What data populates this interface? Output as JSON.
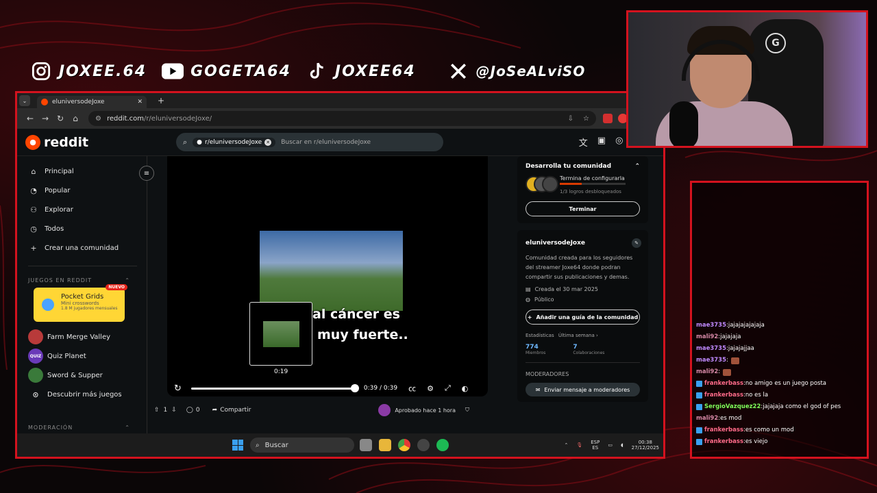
{
  "socials": [
    {
      "icon": "instagram-icon",
      "handle": "JOXEE.64"
    },
    {
      "icon": "youtube-icon",
      "handle": "GOGETA64"
    },
    {
      "icon": "tiktok-icon",
      "handle": "JOXEE64"
    },
    {
      "icon": "x-icon",
      "handle": "@JoSeALviSO"
    }
  ],
  "browser": {
    "tab_title": "eluniversodeJoxe",
    "url_host": "reddit.com",
    "url_path": "/r/eluniversodeJoxe/"
  },
  "reddit": {
    "logo_text": "reddit",
    "search_chip": "r/eluniversodeJoxe",
    "search_placeholder": "Buscar en r/eluniversodeJoxe",
    "nav": [
      {
        "icon": "home-icon",
        "label": "Principal"
      },
      {
        "icon": "popular-icon",
        "label": "Popular"
      },
      {
        "icon": "explore-icon",
        "label": "Explorar"
      },
      {
        "icon": "all-icon",
        "label": "Todos"
      },
      {
        "icon": "plus-icon",
        "label": "Crear una comunidad"
      }
    ],
    "games_section": "JUEGOS EN REDDIT",
    "featured_game": {
      "title": "Pocket Grids",
      "subtitle": "Mini crosswords",
      "meta": "1.8 M jugadores mensuales",
      "badge": "NUEVO"
    },
    "games": [
      {
        "label": "Farm Merge Valley",
        "color": "#b83a3a",
        "abbr": ""
      },
      {
        "label": "Quiz Planet",
        "color": "#6a3ab8",
        "abbr": "QUIZ"
      },
      {
        "label": "Sword & Supper",
        "color": "#3a7a3a",
        "abbr": ""
      },
      {
        "label": "Descubrir más juegos",
        "color": "",
        "abbr": ""
      }
    ],
    "moderation_section": "MODERACIÓN"
  },
  "video": {
    "subtitle_line1": "al cáncer es",
    "subtitle_line2": "muy fuerte..",
    "hover_time": "0:19",
    "time": "0:39 / 0:39",
    "progress": 1.0
  },
  "post_actions": {
    "votes": "1",
    "comments": "0",
    "share": "Compartir",
    "approved": "Aprobado hace 1 hora"
  },
  "sidebar": {
    "grow_title": "Desarrolla tu comunidad",
    "grow_task": "Termina de configurarla",
    "grow_progress": "1/3 logros desbloqueados",
    "grow_button": "Terminar",
    "about_title": "eluniversodeJoxe",
    "about_desc": "Comunidad creada para los seguidores del streamer Joxe64 donde podran compartir sus publicaciones y demas.",
    "created": "Creada el 30 mar 2025",
    "visibility": "Público",
    "guide_button": "Añadir una guía de la comunidad",
    "stats_label": "Estadísticas",
    "stats_period": "Última semana",
    "members_value": "774",
    "members_label": "Miembros",
    "contrib_value": "7",
    "contrib_label": "Colaboraciones",
    "mods_label": "MODERADORES",
    "mods_button": "Enviar mensaje a moderadores"
  },
  "taskbar": {
    "search": "Buscar",
    "lang1": "ESP",
    "lang2": "ES",
    "time": "00:38",
    "date": "27/12/2025"
  },
  "chat": [
    {
      "user": "mae3735",
      "color": "#c08aff",
      "text": "jajajajajajaja",
      "badge": false,
      "emote": false
    },
    {
      "user": "mali92",
      "color": "#d78aa8",
      "text": "jajajaja",
      "badge": false,
      "emote": false
    },
    {
      "user": "mae3735",
      "color": "#c08aff",
      "text": "jajajajjaa",
      "badge": false,
      "emote": false
    },
    {
      "user": "mae3735",
      "color": "#c08aff",
      "text": "",
      "badge": false,
      "emote": true
    },
    {
      "user": "mali92",
      "color": "#d78aa8",
      "text": "",
      "badge": false,
      "emote": true
    },
    {
      "user": "frankerbass",
      "color": "#ff6b8a",
      "text": "no amigo es un juego posta",
      "badge": true,
      "emote": false
    },
    {
      "user": "frankerbass",
      "color": "#ff6b8a",
      "text": "no es la",
      "badge": true,
      "emote": false
    },
    {
      "user": "SergioVazquez22",
      "color": "#7fff5a",
      "text": "jajajaja como el god of pes",
      "badge": true,
      "emote": false
    },
    {
      "user": "mali92",
      "color": "#d78aa8",
      "text": "es mod",
      "badge": false,
      "emote": false
    },
    {
      "user": "frankerbass",
      "color": "#ff6b8a",
      "text": "es como un mod",
      "badge": true,
      "emote": false
    },
    {
      "user": "frankerbass",
      "color": "#ff6b8a",
      "text": "es viejo",
      "badge": true,
      "emote": false
    }
  ]
}
